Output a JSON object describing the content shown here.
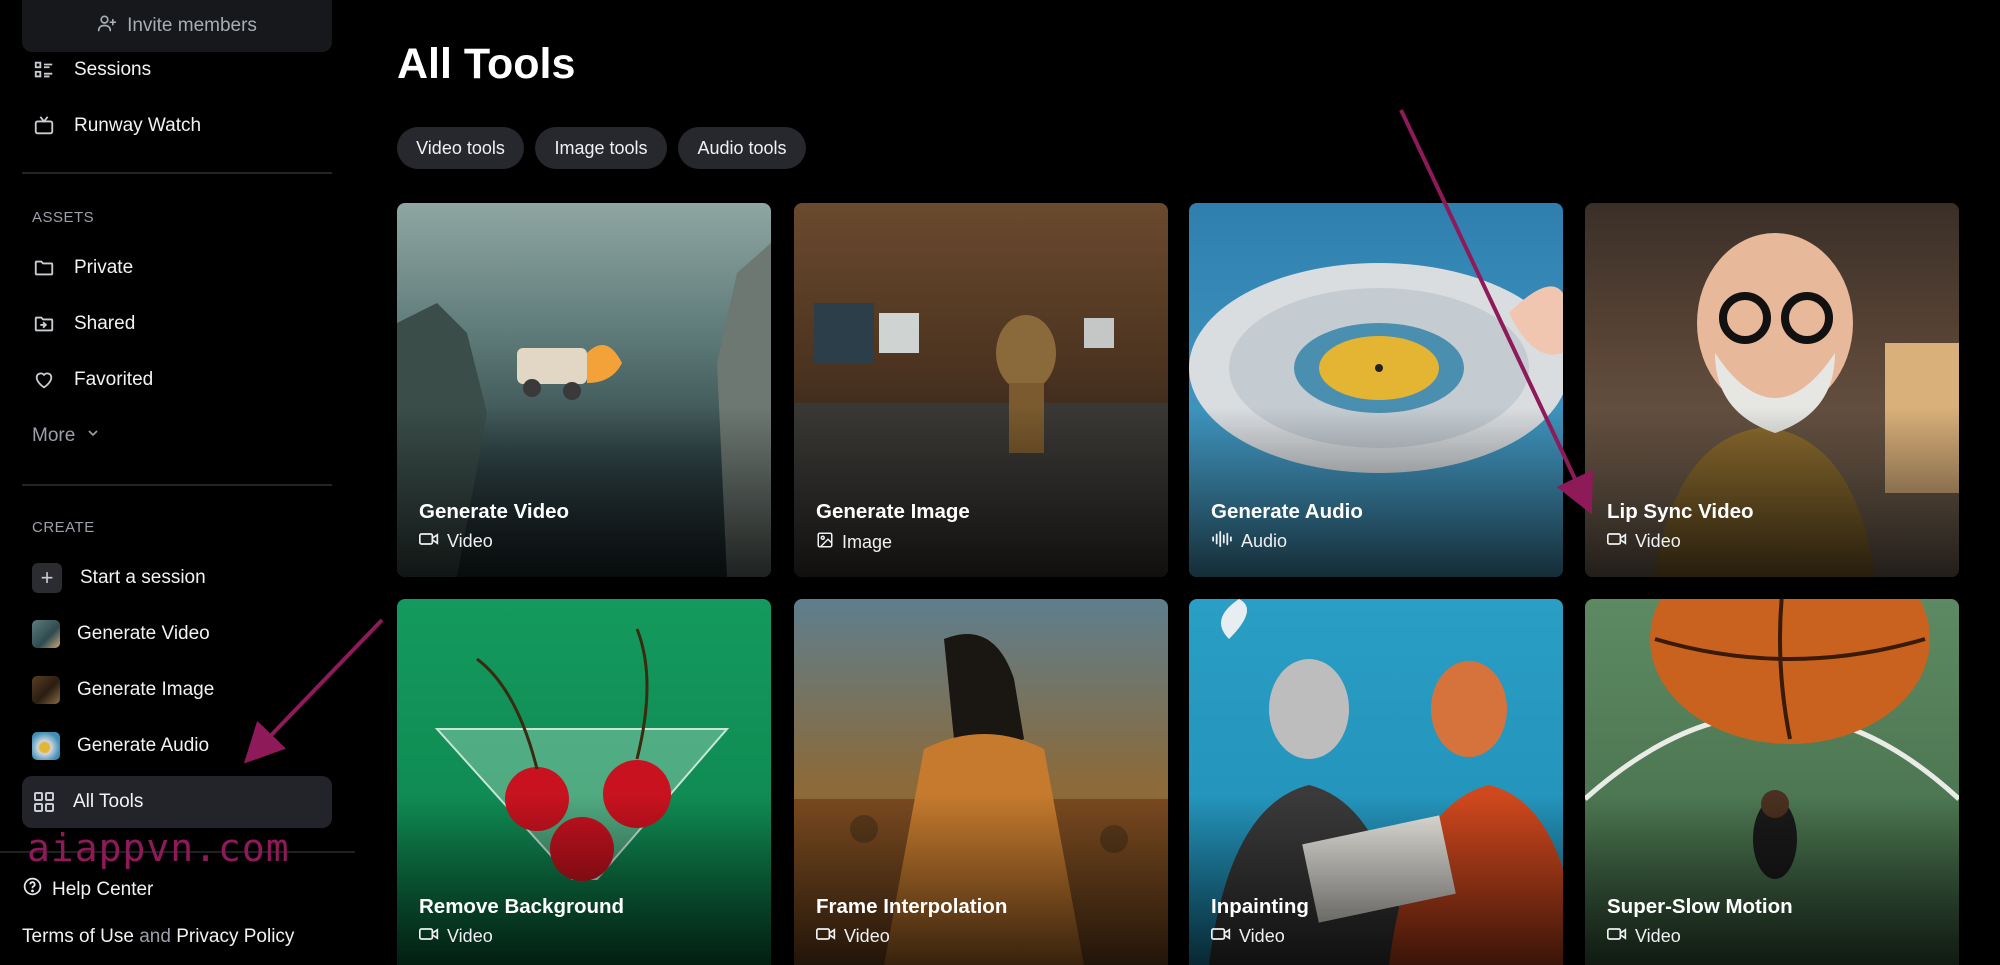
{
  "sidebar": {
    "invite_label": "Invite members",
    "nav_top": [
      {
        "label": "Sessions",
        "icon": "sessions-list-icon"
      },
      {
        "label": "Runway Watch",
        "icon": "tv-icon"
      }
    ],
    "assets_label": "ASSETS",
    "assets": [
      {
        "label": "Private",
        "icon": "folder-icon"
      },
      {
        "label": "Shared",
        "icon": "shared-folder-icon"
      },
      {
        "label": "Favorited",
        "icon": "heart-icon"
      }
    ],
    "more_label": "More",
    "create_label": "CREATE",
    "create": [
      {
        "label": "Start a session",
        "icon": "plus-icon"
      },
      {
        "label": "Generate Video",
        "icon": "video-thumbnail"
      },
      {
        "label": "Generate Image",
        "icon": "image-thumbnail"
      },
      {
        "label": "Generate Audio",
        "icon": "audio-thumbnail"
      },
      {
        "label": "All Tools",
        "icon": "grid-icon"
      }
    ],
    "watermark": "aiappvn.com",
    "help_label": "Help Center",
    "terms_label": "Terms of Use",
    "and_label": "and",
    "privacy_label": "Privacy Policy"
  },
  "main": {
    "title": "All Tools",
    "filters": [
      "Video tools",
      "Image tools",
      "Audio tools"
    ],
    "cards": [
      {
        "title": "Generate Video",
        "type": "Video",
        "type_icon": "video-camera-icon"
      },
      {
        "title": "Generate Image",
        "type": "Image",
        "type_icon": "image-icon"
      },
      {
        "title": "Generate Audio",
        "type": "Audio",
        "type_icon": "audio-wave-icon"
      },
      {
        "title": "Lip Sync Video",
        "type": "Video",
        "type_icon": "video-camera-icon"
      },
      {
        "title": "Remove Background",
        "type": "Video",
        "type_icon": "video-camera-icon"
      },
      {
        "title": "Frame Interpolation",
        "type": "Video",
        "type_icon": "video-camera-icon"
      },
      {
        "title": "Inpainting",
        "type": "Video",
        "type_icon": "video-camera-icon"
      },
      {
        "title": "Super-Slow Motion",
        "type": "Video",
        "type_icon": "video-camera-icon"
      }
    ]
  },
  "colors": {
    "background": "#000000",
    "sidebar_active": "#222429",
    "pill_bg": "#26282d",
    "annotation_arrow": "#8f1a5a"
  }
}
